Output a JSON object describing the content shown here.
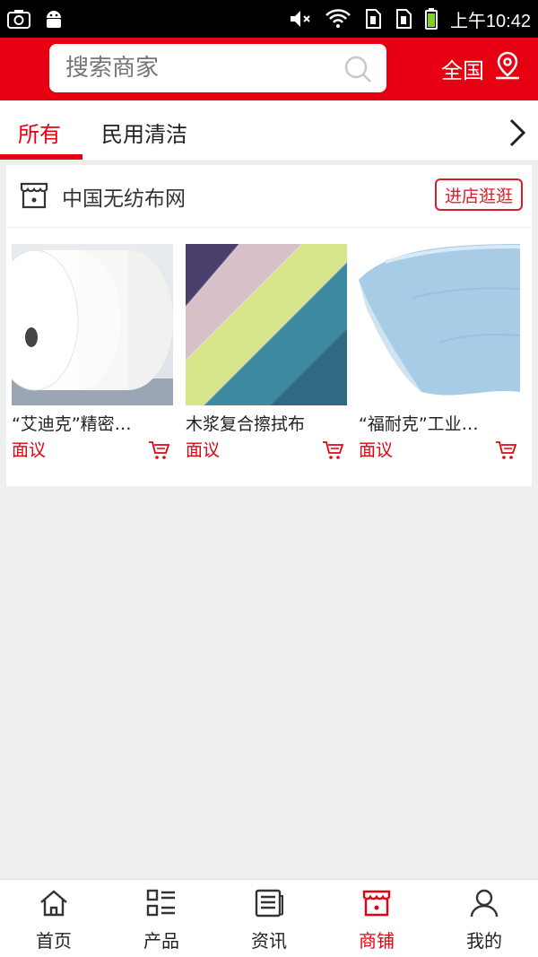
{
  "status_bar": {
    "time": "上午10:42"
  },
  "search": {
    "placeholder": "搜索商家"
  },
  "region": {
    "label": "全国"
  },
  "tabs": [
    {
      "label": "所有",
      "active": true
    },
    {
      "label": "民用清洁",
      "active": false
    }
  ],
  "store": {
    "name": "中国无纺布网",
    "visit_label": "进店逛逛",
    "products": [
      {
        "name": "“艾迪克”精密…",
        "price": "面议"
      },
      {
        "name": "木浆复合擦拭布",
        "price": "面议"
      },
      {
        "name": "“福耐克”工业…",
        "price": "面议"
      }
    ]
  },
  "bottom_nav": [
    {
      "label": "首页",
      "icon": "home-icon"
    },
    {
      "label": "产品",
      "icon": "list-icon"
    },
    {
      "label": "资讯",
      "icon": "news-icon"
    },
    {
      "label": "商铺",
      "icon": "store-icon",
      "active": true
    },
    {
      "label": "我的",
      "icon": "user-icon"
    }
  ],
  "colors": {
    "brand_red": "#e60012"
  }
}
